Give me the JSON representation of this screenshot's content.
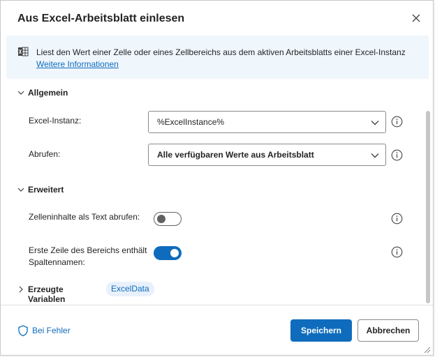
{
  "dialog": {
    "title": "Aus Excel-Arbeitsblatt einlesen",
    "close_icon": "close-icon"
  },
  "info": {
    "icon": "excel-sheet-icon",
    "text": "Liest den Wert einer Zelle oder eines Zellbereichs aus dem aktiven Arbeitsblatts einer Excel-Instanz",
    "link": "Weitere Informationen"
  },
  "general": {
    "title": "Allgemein",
    "instance_label": "Excel-Instanz:",
    "instance_value": "%ExcelInstance%",
    "retrieve_label": "Abrufen:",
    "retrieve_value": "Alle verfügbaren Werte aus Arbeitsblatt"
  },
  "advanced": {
    "title": "Erweitert",
    "cell_text_label": "Zelleninhalte als Text abrufen:",
    "cell_text_on": false,
    "header_label_line1": "Erste Zeile des Bereichs enthält",
    "header_label_line2": "Spaltennamen:",
    "header_on": true
  },
  "variables": {
    "title": "Erzeugte Variablen",
    "badge": "ExcelData"
  },
  "footer": {
    "error_link": "Bei Fehler",
    "save": "Speichern",
    "cancel": "Abbrechen"
  },
  "colors": {
    "accent": "#0f6cbd",
    "info_bg": "#eff6fc"
  }
}
